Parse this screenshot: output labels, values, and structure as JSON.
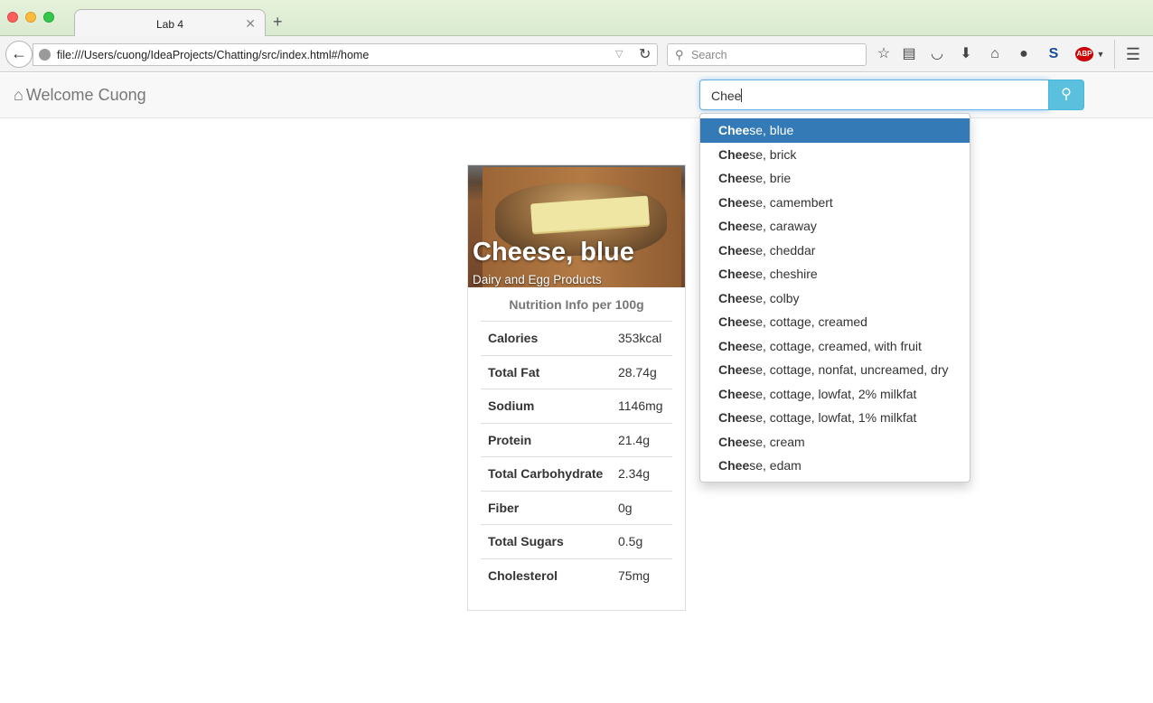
{
  "browser": {
    "tab_title": "Lab 4",
    "url": "file:///Users/cuong/IdeaProjects/Chatting/src/index.html#/home",
    "search_placeholder": "Search",
    "abp_label": "ABP",
    "s_label": "S"
  },
  "header": {
    "brand": "Welcome Cuong",
    "search_value": "Chee"
  },
  "autocomplete": {
    "match": "Chee",
    "items": [
      "se, blue",
      "se, brick",
      "se, brie",
      "se, camembert",
      "se, caraway",
      "se, cheddar",
      "se, cheshire",
      "se, colby",
      "se, cottage, creamed",
      "se, cottage, creamed, with fruit",
      "se, cottage, nonfat, uncreamed, dry",
      "se, cottage, lowfat, 2% milkfat",
      "se, cottage, lowfat, 1% milkfat",
      "se, cream",
      "se, edam"
    ]
  },
  "card": {
    "title": "Cheese, blue",
    "subtitle": "Dairy and Egg Products",
    "nutrition_heading": "Nutrition Info per 100g",
    "rows": [
      {
        "label": "Calories",
        "value": "353kcal"
      },
      {
        "label": "Total Fat",
        "value": "28.74g"
      },
      {
        "label": "Sodium",
        "value": "1146mg"
      },
      {
        "label": "Protein",
        "value": "21.4g"
      },
      {
        "label": "Total Carbohydrate",
        "value": "2.34g"
      },
      {
        "label": "Fiber",
        "value": "0g"
      },
      {
        "label": "Total Sugars",
        "value": "0.5g"
      },
      {
        "label": "Cholesterol",
        "value": "75mg"
      }
    ]
  },
  "colors": {
    "active_item": "#337ab7",
    "search_button": "#5bc0de"
  }
}
